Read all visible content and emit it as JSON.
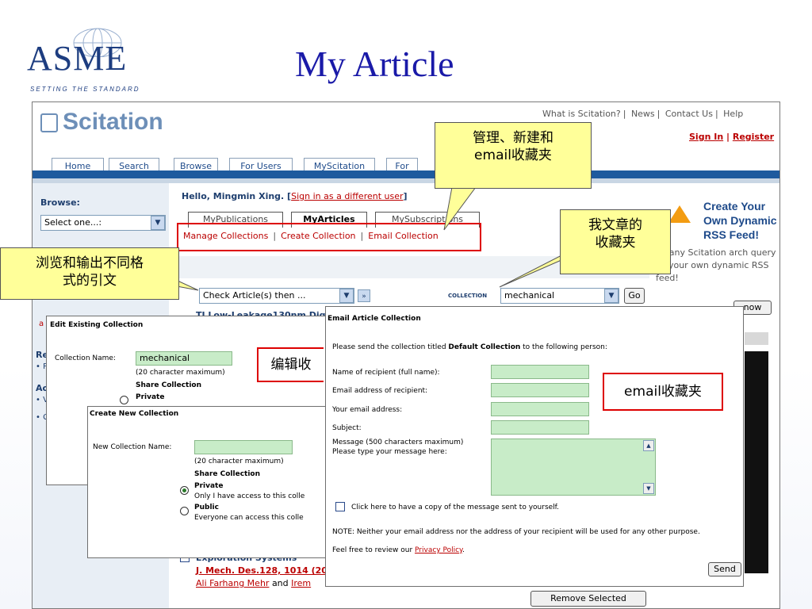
{
  "slide": {
    "title": "My Article",
    "logo_text": "ASME",
    "logo_tagline": "SETTING THE STANDARD"
  },
  "scitation": {
    "logo_text": "Scitation",
    "top_links": [
      "What is Scitation?",
      "News",
      "Contact Us",
      "Help"
    ],
    "sign_in": "Sign In",
    "register": "Register",
    "nav_tabs": [
      "Home",
      "Search",
      "Browse",
      "For Users",
      "MyScitation",
      "For"
    ],
    "browse_label": "Browse:",
    "browse_select": "Select one...:",
    "hello_text": "Hello, Mingmin Xing. [",
    "hello_link": "Sign in as a different user",
    "hello_end": "]",
    "sub_tabs": [
      "MyPublications",
      "MyArticles",
      "MySubscriptions"
    ],
    "manage_links": [
      "Manage Collections",
      "Create Collection",
      "Email Collection"
    ],
    "check_article_select": "Check Article(s) then ...",
    "collection_label": "COLLECTION",
    "collection_select": "mechanical",
    "go_label": "Go",
    "rss_title": "Create Your Own Dynamic RSS Feed!",
    "rss_text": "ve any Scitation arch query as your own dynamic RSS feed!",
    "rss_button": "now",
    "first_article": "TI Low-Leakage130nm Dig",
    "bottom_article_title": "Exploration Systems",
    "bottom_article_ref": "J. Mech. Des.128, 1014 (200",
    "bottom_authors": [
      "Ali Farhang Mehr",
      "Irem"
    ],
    "bottom_and": "and",
    "remove_selected": "Remove Selected",
    "left_fragments": [
      "a",
      "Re",
      "• P",
      "Ac",
      "• V",
      "• C"
    ]
  },
  "edit_dialog": {
    "title": "Edit Existing Collection",
    "name_label": "Collection Name:",
    "name_value": "mechanical",
    "max_note": "(20 character maximum)",
    "share_label": "Share Collection",
    "private_label": "Private",
    "partial_text": "O ..."
  },
  "create_dialog": {
    "title": "Create New Collection",
    "name_label": "New Collection Name:",
    "name_value": "",
    "max_note": "(20 character maximum)",
    "share_label": "Share Collection",
    "private_label": "Private",
    "private_desc": "Only I have access to this colle",
    "public_label": "Public",
    "public_desc": "Everyone can access this colle"
  },
  "email_dialog": {
    "title": "Email Article Collection",
    "intro_pre": "Please send the collection titled ",
    "intro_bold": "Default Collection",
    "intro_post": " to the following person:",
    "recipient_name_label": "Name of recipient (full name):",
    "recipient_email_label": "Email address of recipient:",
    "your_email_label": "Your email address:",
    "subject_label": "Subject:",
    "message_label": "Message (500 characters maximum)",
    "message_hint": "Please type your message here:",
    "copy_label": "Click here to have a copy of the message sent to yourself.",
    "note": "NOTE: Neither your email address nor the address of your recipient will be used for any other purpose.",
    "review_pre": "Feel free to review our ",
    "privacy_link": "Privacy Policy",
    "review_post": ".",
    "send_label": "Send"
  },
  "callouts": {
    "manage": "管理、新建和\nemail收藏夹",
    "my_collection": "我文章的\n收藏夹",
    "browse_export": "浏览和输出不同格\n式的引文",
    "edit": "编辑收",
    "email": "email收藏夹"
  },
  "colors": {
    "slide_title": "#1a1aa8",
    "asme_blue": "#1d3d80",
    "scitation_blue": "#6d8fb8",
    "nav_bar": "#1e5a9e",
    "link_red": "#b00",
    "field_green": "#c8ecc8",
    "callout_yellow": "#ffff99",
    "annot_red": "#d00"
  },
  "icons": [
    "asme-globe-icon",
    "scitation-logo-icon",
    "rss-icon",
    "dropdown-arrow-icon",
    "forward-arrow-icon",
    "scroll-up-icon",
    "scroll-down-icon"
  ]
}
